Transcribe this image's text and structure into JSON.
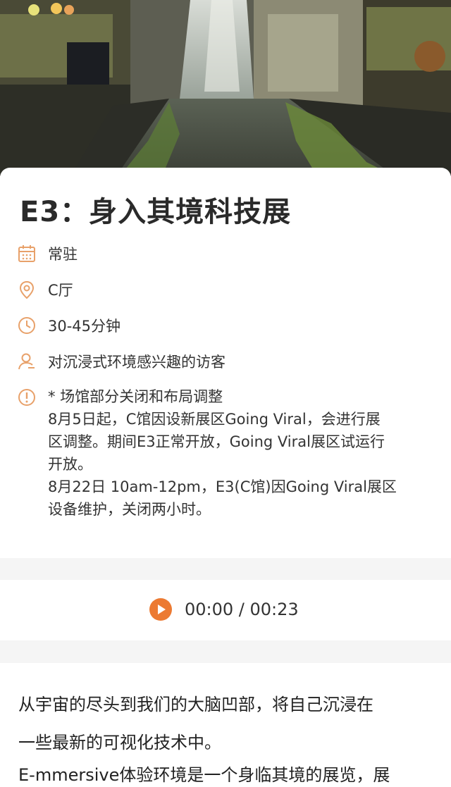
{
  "event": {
    "title": "E3：身入其境科技展",
    "schedule": "常驻",
    "location": "C厅",
    "duration": "30-45分钟",
    "audience": "对沉浸式环境感兴趣的访客",
    "notice": {
      "line1": "* 场馆部分关闭和布局调整",
      "line2": "8月5日起，C馆因设新展区Going Viral，会进行展",
      "line3": "区调整。期间E3正常开放，Going Viral展区试运行",
      "line4": "开放。",
      "line5": "8月22日 10am-12pm，E3(C馆)因Going Viral展区",
      "line6": "设备维护，关闭两小时。"
    }
  },
  "audio": {
    "time": "00:00 / 00:23"
  },
  "article": {
    "line1": "从宇宙的尽头到我们的大脑凹部，将自己沉浸在",
    "line2": "一些最新的可视化技术中。",
    "line3": "E-mmersive体验环境是一个身临其境的展览，展"
  },
  "colors": {
    "accent": "#ec7a32",
    "icon": "#e8a16a"
  }
}
